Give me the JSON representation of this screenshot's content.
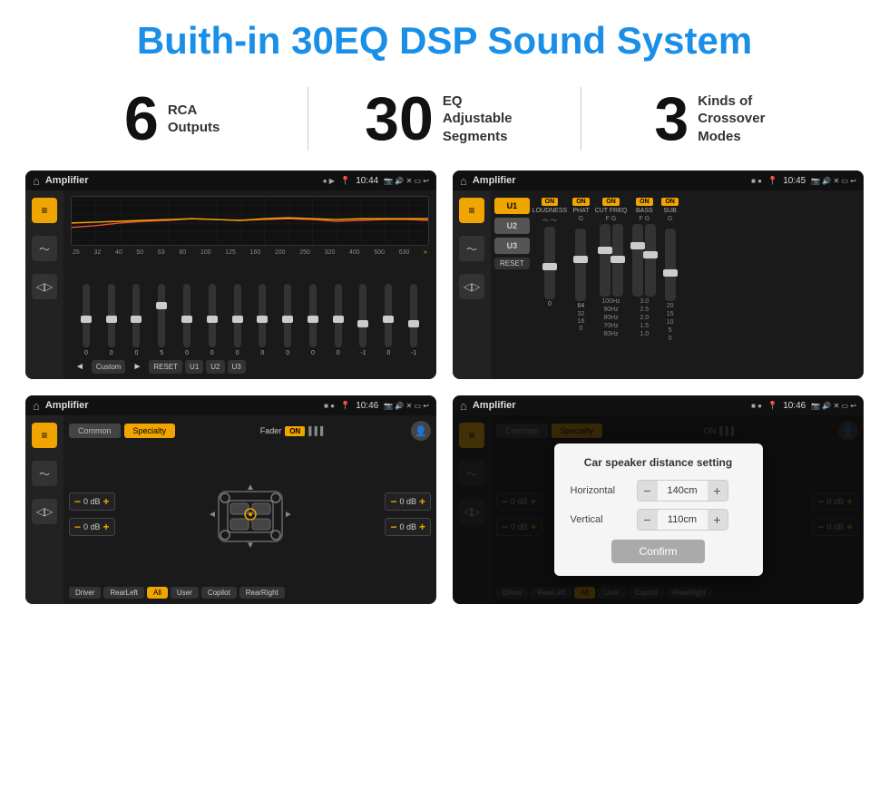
{
  "page": {
    "title": "Buith-in 30EQ DSP Sound System"
  },
  "stats": [
    {
      "number": "6",
      "label": "RCA\nOutputs"
    },
    {
      "number": "30",
      "label": "EQ Adjustable\nSegments"
    },
    {
      "number": "3",
      "label": "Kinds of\nCrossover Modes"
    }
  ],
  "screens": [
    {
      "id": "screen-eq",
      "title": "Amplifier",
      "time": "10:44",
      "type": "eq"
    },
    {
      "id": "screen-amp",
      "title": "Amplifier",
      "time": "10:45",
      "type": "amp"
    },
    {
      "id": "screen-fader",
      "title": "Amplifier",
      "time": "10:46",
      "type": "fader"
    },
    {
      "id": "screen-distance",
      "title": "Amplifier",
      "time": "10:46",
      "type": "distance"
    }
  ],
  "eq": {
    "frequencies": [
      "25",
      "32",
      "40",
      "50",
      "63",
      "80",
      "100",
      "125",
      "160",
      "200",
      "250",
      "320",
      "400",
      "500",
      "630"
    ],
    "values": [
      "0",
      "0",
      "0",
      "5",
      "0",
      "0",
      "0",
      "0",
      "0",
      "0",
      "0",
      "-1",
      "0",
      "-1"
    ],
    "presets": [
      "Custom",
      "RESET",
      "U1",
      "U2",
      "U3"
    ]
  },
  "amp": {
    "presets": [
      "U1",
      "U2",
      "U3"
    ],
    "channels": [
      {
        "label": "LOUDNESS",
        "on": true
      },
      {
        "label": "PHAT",
        "on": true
      },
      {
        "label": "CUT FREQ",
        "on": true
      },
      {
        "label": "BASS",
        "on": true
      },
      {
        "label": "SUB",
        "on": true
      }
    ],
    "reset": "RESET"
  },
  "fader": {
    "tabs": [
      "Common",
      "Specialty"
    ],
    "active_tab": "Specialty",
    "fader_label": "Fader",
    "toggle": "ON",
    "db_values": [
      "0 dB",
      "0 dB",
      "0 dB",
      "0 dB"
    ],
    "buttons": [
      "Driver",
      "RearLeft",
      "All",
      "User",
      "Copilot",
      "RearRight"
    ]
  },
  "distance": {
    "tabs": [
      "Common",
      "Specialty"
    ],
    "dialog_title": "Car speaker distance setting",
    "horizontal_label": "Horizontal",
    "horizontal_value": "140cm",
    "vertical_label": "Vertical",
    "vertical_value": "110cm",
    "confirm_label": "Confirm",
    "db_values": [
      "0 dB",
      "0 dB"
    ],
    "buttons": [
      "Driver",
      "RearLeft",
      "All",
      "User",
      "Copilot",
      "RearRight"
    ]
  }
}
